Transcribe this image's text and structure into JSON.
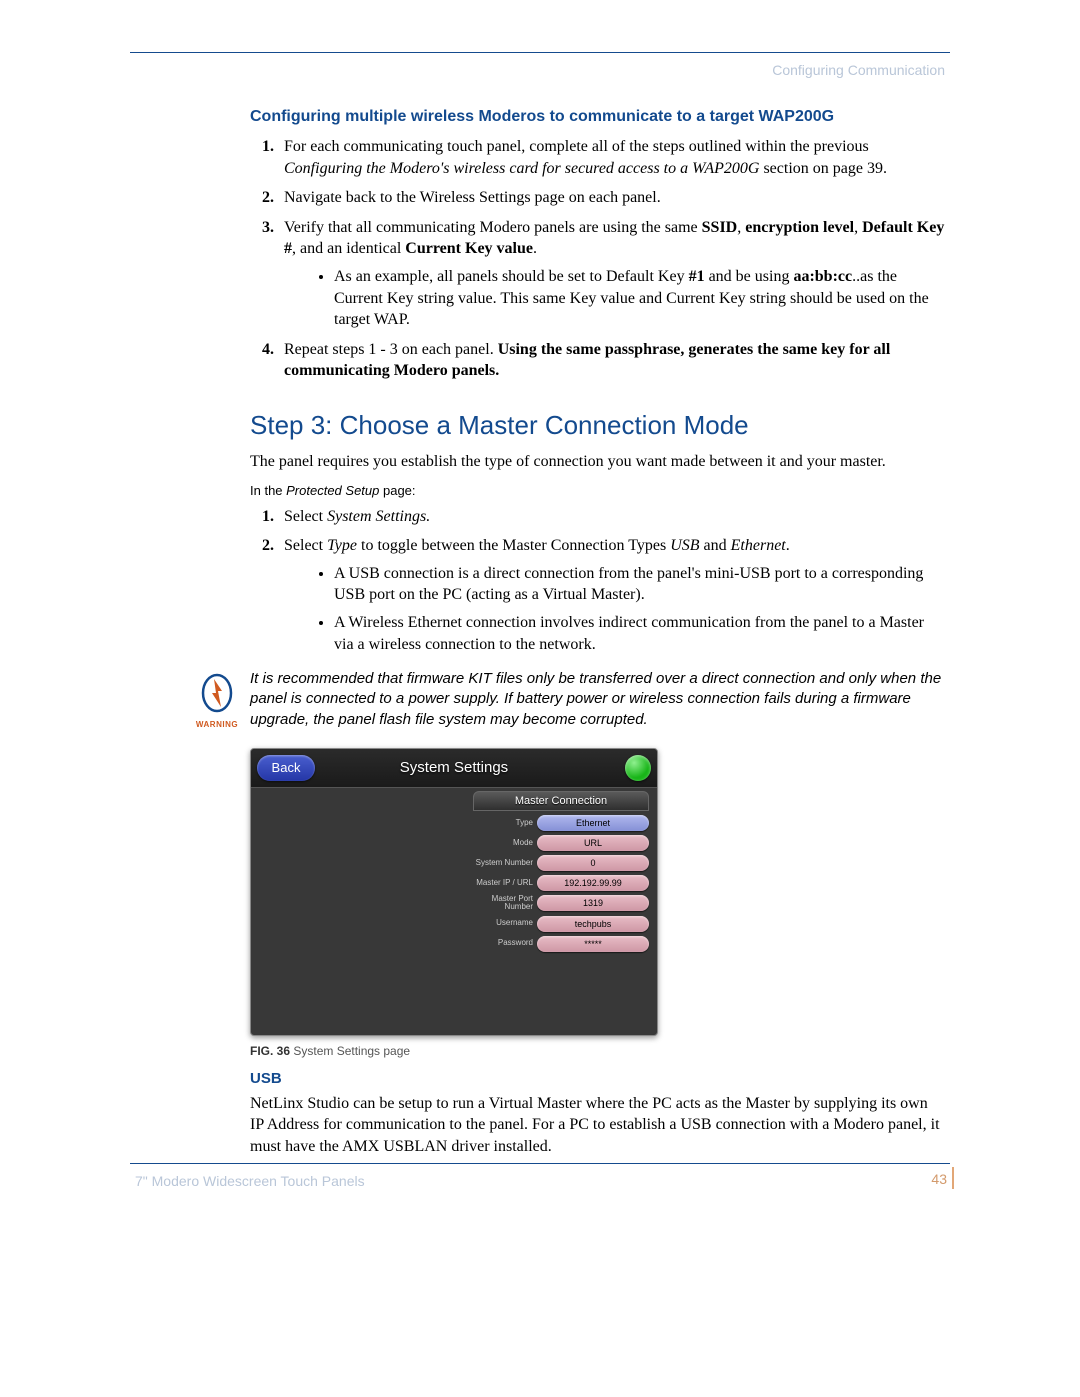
{
  "header": {
    "section": "Configuring Communication"
  },
  "h4": "Configuring multiple wireless Moderos to communicate to a target WAP200G",
  "list1": {
    "i1a": "For each communicating touch panel, complete all of the steps outlined within the previous ",
    "i1b": "Configuring the Modero's wireless card for secured access to a WAP200G",
    "i1c": " section on page 39.",
    "i2": "Navigate back to the Wireless Settings page on each panel.",
    "i3a": "Verify that all communicating Modero panels are using the same ",
    "i3b": "SSID",
    "i3c": ", ",
    "i3d": "encryption level",
    "i3e": ", ",
    "i3f": "Default Key #",
    "i3g": ", and an identical ",
    "i3h": "Current Key value",
    "i3i": ".",
    "b1a": "As an example, all panels should be set to Default Key ",
    "b1b": "#1",
    "b1c": " and be using ",
    "b1d": "aa:bb:cc",
    "b1e": "..as the Current Key string value. This same Key value and Current Key string should be used on the target WAP.",
    "i4a": "Repeat steps 1 - 3 on each panel. ",
    "i4b": "Using the same passphrase, generates the same key for all communicating Modero panels."
  },
  "h2": "Step 3: Choose a Master Connection Mode",
  "p1": "The panel requires you establish the type of connection you want made between it and your master.",
  "small": {
    "a": "In the ",
    "b": "Protected Setup",
    "c": " page:"
  },
  "list2": {
    "i1a": "Select ",
    "i1b": "System Settings.",
    "i2a": "Select ",
    "i2b": "Type",
    "i2c": " to toggle between the Master Connection Types ",
    "i2d": "USB",
    "i2e": " and ",
    "i2f": "Ethernet",
    "i2g": ".",
    "b1": "A USB connection is a direct connection from the panel's mini-USB port to a corresponding USB port on the PC (acting as a Virtual Master).",
    "b2": "A Wireless Ethernet connection involves indirect communication from the panel to a Master via a wireless connection to the network."
  },
  "warning": {
    "label": "WARNING",
    "text": "It is recommended that firmware KIT files only be transferred over a direct connection and only when the panel is connected to a power supply. If battery power or wireless connection fails during a firmware upgrade, the panel flash file system may become corrupted."
  },
  "figure": {
    "back": "Back",
    "title": "System Settings",
    "mc_heading": "Master Connection",
    "rows": [
      {
        "label": "Type",
        "value": "Ethernet",
        "style": "blue"
      },
      {
        "label": "Mode",
        "value": "URL",
        "style": "pink"
      },
      {
        "label": "System Number",
        "value": "0",
        "style": "pink"
      },
      {
        "label": "Master IP / URL",
        "value": "192.192.99.99",
        "style": "pink"
      },
      {
        "label": "Master Port Number",
        "value": "1319",
        "style": "pink"
      },
      {
        "label": "Username",
        "value": "techpubs",
        "style": "pink"
      },
      {
        "label": "Password",
        "value": "*****",
        "style": "pink"
      }
    ],
    "caption_num": "FIG. 36",
    "caption_text": "  System Settings page"
  },
  "h5": "USB",
  "p2": "NetLinx Studio can be setup to run a Virtual Master where the PC acts as the Master by supplying its own IP Address for communication to the panel. For a PC to establish a USB connection with a Modero panel, it must have the AMX USBLAN driver installed.",
  "footer": {
    "left": "7\" Modero Widescreen Touch Panels",
    "page": "43"
  }
}
